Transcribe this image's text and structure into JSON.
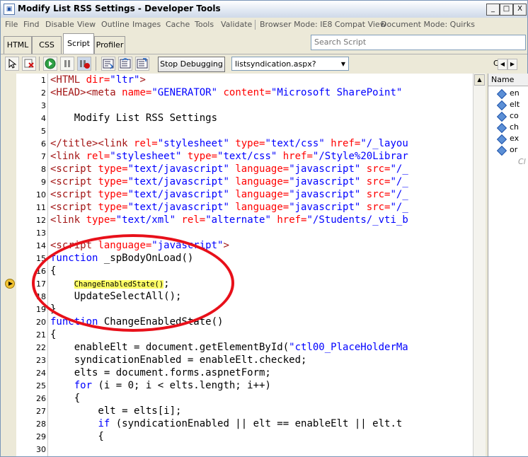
{
  "window": {
    "title": "Modify List RSS Settings - Developer Tools",
    "controls": [
      "_",
      "□",
      "X"
    ]
  },
  "menu": {
    "items": [
      "File",
      "Find",
      "Disable",
      "View",
      "Outline",
      "Images",
      "Cache",
      "Tools",
      "Validate"
    ],
    "browser_mode": "Browser Mode: IE8 Compat View",
    "document_mode": "Document Mode: Quirks"
  },
  "tabs": [
    "HTML",
    "CSS",
    "Script",
    "Profiler"
  ],
  "search": {
    "placeholder": "Search Script"
  },
  "toolbar": {
    "stop_debugging": "Stop Debugging",
    "script_file": "listsyndication.aspx?List=%...",
    "cut_label": "Co"
  },
  "code": {
    "line_numbers": [
      "1",
      "2",
      "3",
      "4",
      "5",
      "6",
      "7",
      "8",
      "9",
      "10",
      "11",
      "12",
      "13",
      "14",
      "15",
      "16",
      "17",
      "18",
      "19",
      "20",
      "21",
      "22",
      "23",
      "24",
      "25",
      "26",
      "27",
      "28",
      "29",
      "30"
    ],
    "l1": [
      "<HTML ",
      "dir=",
      "\"ltr\"",
      ">"
    ],
    "l2": [
      "<HEAD><meta ",
      "name=",
      "\"GENERATOR\"",
      " content=",
      "\"Microsoft SharePoint\""
    ],
    "l4": "    Modify List RSS Settings",
    "l6": [
      "</title><link ",
      "rel=",
      "\"stylesheet\"",
      " type=",
      "\"text/css\"",
      " href=",
      "\"/_layou"
    ],
    "l7": [
      "<link ",
      "rel=",
      "\"stylesheet\"",
      " type=",
      "\"text/css\"",
      " href=",
      "\"/Style%20Librar"
    ],
    "script_tag": "<script ",
    "type_attr": "type=",
    "type_val": "\"text/javascript\"",
    "lang_attr": " language=",
    "lang_val": "\"javascript\"",
    "src_attr": " src=",
    "src_val": "\"/_",
    "l12": [
      "<link ",
      "type=",
      "\"text/xml\"",
      " rel=",
      "\"alternate\"",
      " href=",
      "\"/Students/_vti_b"
    ],
    "l14": [
      "<script ",
      "language=",
      "\"javascript\"",
      ">"
    ],
    "kw_function": "function",
    "l15": " _spBodyOnLoad()",
    "brace_open": "{",
    "brace_close": "}",
    "l17": "ChangeEnabledState()",
    "l17_end": ";",
    "l18": "    UpdateSelectAll();",
    "l20": " ChangeEnabledState()",
    "l22": [
      "    enableElt = document.getElementById(",
      "\"ctl00_PlaceHolderMa"
    ],
    "l23": "    syndicationEnabled = enableElt.checked;",
    "l24": "    elts = document.forms.aspnetForm;",
    "kw_for": "for",
    "l25": " (i = 0; i < elts.length; i++)",
    "l26": "    {",
    "l27": "        elt = elts[i];",
    "kw_if": "if",
    "l28": " (syndicationEnabled || elt == enableElt || elt.t",
    "l29": "        {"
  },
  "right_pane": {
    "header": "Name",
    "items": [
      "en",
      "elt",
      "co",
      "ch",
      "ex",
      "or"
    ],
    "footer": "Cl"
  },
  "colors": {
    "tag": "#a31515",
    "attr": "#ff0000",
    "string": "#0000ff",
    "keyword": "#0000ff",
    "highlight": "#ffff66",
    "annotation": "#e8101a"
  }
}
